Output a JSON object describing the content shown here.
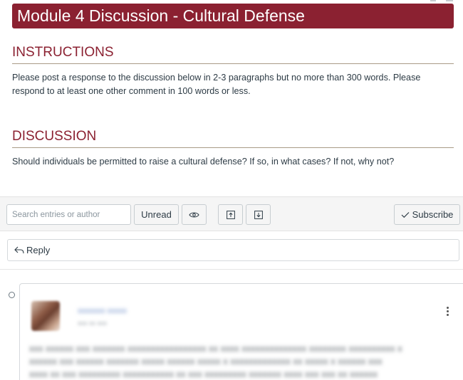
{
  "page": {
    "title": "Module  4  Discussion - Cultural Defense"
  },
  "instructions": {
    "heading": "INSTRUCTIONS",
    "text": "Please post a response to the discussion below in 2-3 paragraphs but no more than 300 words. Please respond to at least one other comment in 100 words or less."
  },
  "discussion": {
    "heading": "DISCUSSION",
    "question": "Should individuals be permitted to raise a cultural defense?  If so, in what cases?  If not, why not?"
  },
  "toolbar": {
    "search_placeholder": "Search entries or author",
    "unread_label": "Unread",
    "view_icon": "eye-icon",
    "collapse_icon": "arrow-up-box-icon",
    "expand_icon": "arrow-down-box-icon",
    "subscribe_label": "Subscribe",
    "subscribe_icon": "check-icon"
  },
  "reply": {
    "label": "Reply",
    "icon": "reply-arrow-icon"
  },
  "colors": {
    "banner": "#8b2131",
    "heading": "#8b2131",
    "text": "#2d3b45"
  }
}
